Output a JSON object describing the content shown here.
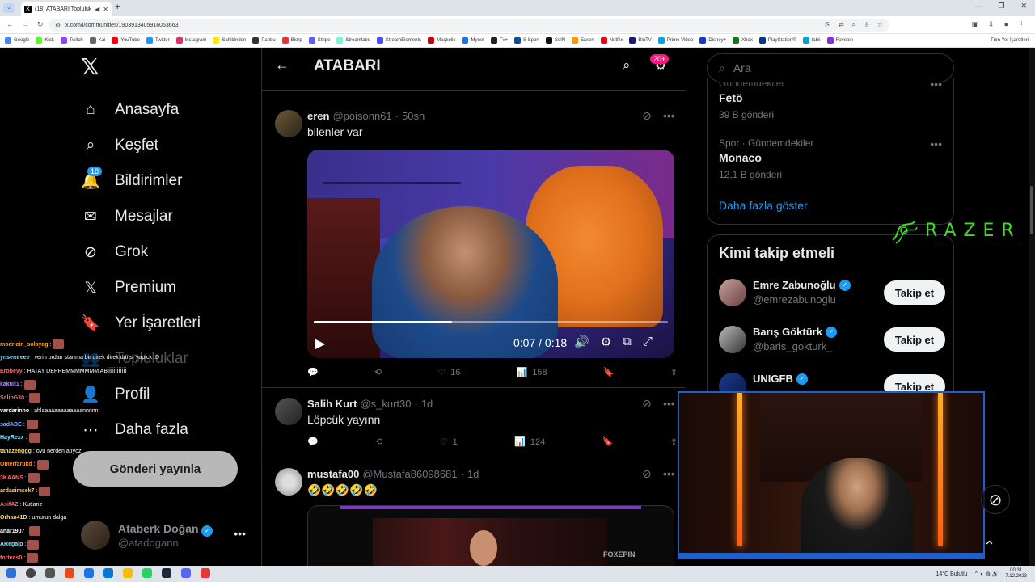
{
  "browser": {
    "tab_title": "(18) ATABARI Topluluk / X",
    "url": "x.com/i/communities/1903913405916053663",
    "bookmarks": [
      "Google",
      "Kick",
      "Twitch",
      "Kai",
      "YouTube",
      "Twitter",
      "Instagram",
      "Sahibinden",
      "Panbu",
      "Blerp",
      "Stripe",
      "Streamlabs",
      "StreamElements",
      "Maçkolik",
      "Mynet",
      "Tv+",
      "S Sport",
      "SelN",
      "Exxen",
      "Netflix",
      "BluTV",
      "Prime Video",
      "Disney+",
      "Xbox",
      "PlayStation®",
      "tabii",
      "Fovepin"
    ],
    "bookmarks_right": "Tüm Yer İşaretleri",
    "bookmark_colors": [
      "#4285f4",
      "#53fc18",
      "#9146ff",
      "#666666",
      "#ff0000",
      "#1d9bf0",
      "#e1306c",
      "#ffe800",
      "#333333",
      "#e33",
      "#635bff",
      "#80f5d2",
      "#4b4bff",
      "#cc0000",
      "#1a73e8",
      "#222222",
      "#0b4f9c",
      "#111111",
      "#ff9900",
      "#e50914",
      "#1a1a80",
      "#00a8e1",
      "#113ccf",
      "#107c10",
      "#003791",
      "#00a0e0",
      "#8a2be2"
    ]
  },
  "nav": {
    "items": [
      {
        "label": "Anasayfa",
        "icon": "home-icon"
      },
      {
        "label": "Keşfet",
        "icon": "search-icon"
      },
      {
        "label": "Bildirimler",
        "icon": "bell-icon",
        "badge": "18"
      },
      {
        "label": "Mesajlar",
        "icon": "mail-icon"
      },
      {
        "label": "Grok",
        "icon": "grok-icon"
      },
      {
        "label": "Premium",
        "icon": "x-premium-icon"
      },
      {
        "label": "Yer İşaretleri",
        "icon": "bookmark-icon"
      },
      {
        "label": "Topluluklar",
        "icon": "communities-icon"
      },
      {
        "label": "Profil",
        "icon": "profile-icon"
      },
      {
        "label": "Daha fazla",
        "icon": "more-circle-icon"
      }
    ],
    "post_button": "Gönderi yayınla",
    "account": {
      "name": "Ataberk Doğan",
      "handle": "@atadogann"
    }
  },
  "chat": [
    {
      "user": "modricin_solayag",
      "color": "#f5a623",
      "msg": ""
    },
    {
      "user": "ynsemreee",
      "color": "#7fe3ff",
      "msg": "verin ordan starıma bir direk direk dansı yapıck :D"
    },
    {
      "user": "Erobeyy",
      "color": "#ff6a6a",
      "msg": "HATAY DEPREMMMMMMM ABİİİİİİİİİİİİ"
    },
    {
      "user": "kakuli1",
      "color": "#b28cff",
      "msg": ""
    },
    {
      "user": "SalihG30",
      "color": "#ff6a6a",
      "msg": ""
    },
    {
      "user": "vardarinho",
      "color": "#ffffff",
      "msg": "ahlaaaaaaaaaaaaannnnn"
    },
    {
      "user": "sadADE",
      "color": "#7fb3ff",
      "msg": ""
    },
    {
      "user": "HayRexx",
      "color": "#7fe3ff",
      "msg": ""
    },
    {
      "user": "tahazenggg",
      "color": "#ffd86a",
      "msg": "oyu nerden atıyoz"
    },
    {
      "user": "Omerfarukd",
      "color": "#ff8a3a",
      "msg": ""
    },
    {
      "user": "3KAANS",
      "color": "#ff6a6a",
      "msg": ""
    },
    {
      "user": "ardasimsek7",
      "color": "#ffd86a",
      "msg": ""
    },
    {
      "user": "AsifAZ",
      "color": "#ff6a6a",
      "msg": "Kutlarız"
    },
    {
      "user": "Orhan41D",
      "color": "#ffd86a",
      "msg": "umurun dalga"
    },
    {
      "user": "anar1907",
      "color": "#ffffff",
      "msg": ""
    },
    {
      "user": "ARegalp",
      "color": "#7fe3ff",
      "msg": ""
    },
    {
      "user": "forteas0",
      "color": "#ff6a6a",
      "msg": ""
    }
  ],
  "header": {
    "title": "ATABARI",
    "badge": "20+"
  },
  "tweets": [
    {
      "name": "eren",
      "handle": "@poisonn61",
      "time": "50sn",
      "text": "bilenler var",
      "video": {
        "time": "0:07 / 0:18",
        "progress": 0.39
      },
      "stats": {
        "replies": "",
        "retweets": "",
        "likes": "16",
        "views": "158"
      }
    },
    {
      "name": "Salih Kurt",
      "handle": "@s_kurt30",
      "time": "1d",
      "text": "Löpcük yayınn",
      "stats": {
        "replies": "",
        "retweets": "",
        "likes": "1",
        "views": "124"
      }
    },
    {
      "name": "mustafa00",
      "handle": "@Mustafa86098681",
      "time": "1d",
      "text": "🤣🤣🤣🤣🤣",
      "video_watermark": "FOXEPIN"
    }
  ],
  "search": {
    "placeholder": "Ara"
  },
  "trends": [
    {
      "category": "Gündemdekiler",
      "name": "Fetö",
      "count": "39 B gönderi"
    },
    {
      "category": "Spor · Gündemdekiler",
      "name": "Monaco",
      "count": "12,1 B gönderi"
    }
  ],
  "show_more": "Daha fazla göster",
  "who_to_follow": {
    "title": "Kimi takip etmeli",
    "items": [
      {
        "name": "Emre Zabunoğlu",
        "handle": "@emrezabunoglu",
        "button": "Takip et"
      },
      {
        "name": "Barış Göktürk",
        "handle": "@baris_gokturk_",
        "button": "Takip et"
      },
      {
        "name": "UNIGFB",
        "handle": "",
        "button": "Takip et"
      }
    ]
  },
  "razer": "RAZER",
  "taskbar": {
    "weather": "14°C  Bulutlu",
    "time": "00:31",
    "date": "7.12.2023"
  },
  "colors": {
    "accent": "#1d9bf0",
    "like": "#f91880",
    "razer_green": "#44d62c",
    "cam_border": "#1f5fcc"
  }
}
